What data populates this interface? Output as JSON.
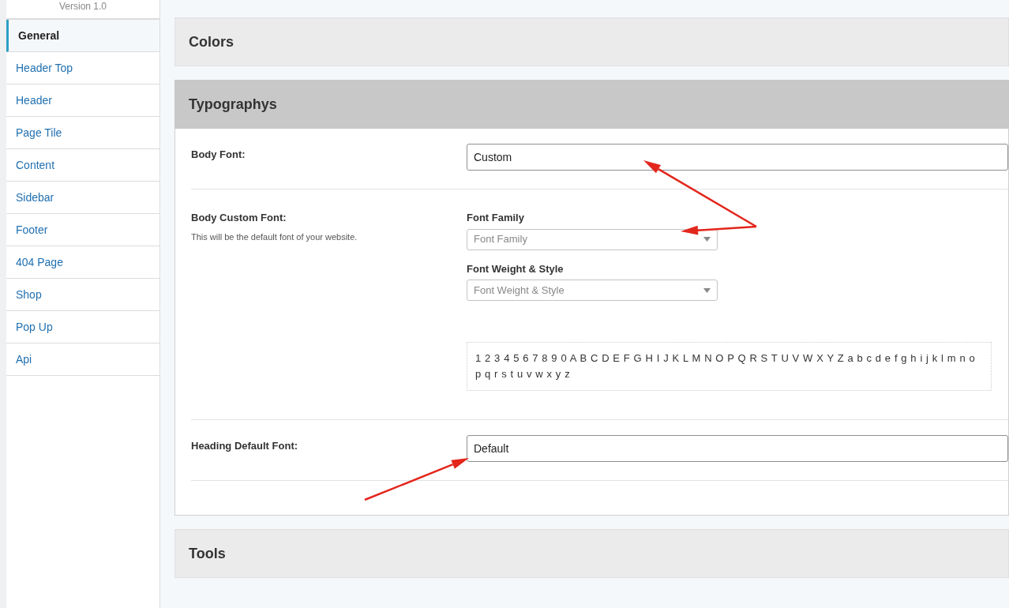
{
  "sidebar": {
    "version": "Version 1.0",
    "items": [
      {
        "label": "General",
        "selected": true
      },
      {
        "label": "Header Top",
        "selected": false
      },
      {
        "label": "Header",
        "selected": false
      },
      {
        "label": "Page Tile",
        "selected": false
      },
      {
        "label": "Content",
        "selected": false
      },
      {
        "label": "Sidebar",
        "selected": false
      },
      {
        "label": "Footer",
        "selected": false
      },
      {
        "label": "404 Page",
        "selected": false
      },
      {
        "label": "Shop",
        "selected": false
      },
      {
        "label": "Pop Up",
        "selected": false
      },
      {
        "label": "Api",
        "selected": false
      }
    ]
  },
  "sections": [
    {
      "title": "Colors",
      "expanded": false
    },
    {
      "title": "Typographys",
      "expanded": true,
      "fields": [
        {
          "kind": "select",
          "label": "Body Font:",
          "value": "Custom"
        },
        {
          "kind": "font",
          "label": "Body Custom Font:",
          "description": "This will be the default font of your website.",
          "dropdowns": [
            {
              "label": "Font Family",
              "placeholder": "Font Family"
            },
            {
              "label": "Font Weight & Style",
              "placeholder": "Font Weight & Style"
            }
          ],
          "preview": "1 2 3 4 5 6 7 8 9 0 A B C D E F G H I J K L M N O P Q R S T U V W X Y Z a b c d e f g h i j k l m n o p q r s t u v w x y z"
        },
        {
          "kind": "select",
          "label": "Heading Default Font:",
          "value": "Default"
        }
      ]
    },
    {
      "title": "Tools",
      "expanded": false
    }
  ],
  "annotations": [
    {
      "kind": "arrow"
    },
    {
      "kind": "arrow"
    },
    {
      "kind": "arrow"
    }
  ]
}
